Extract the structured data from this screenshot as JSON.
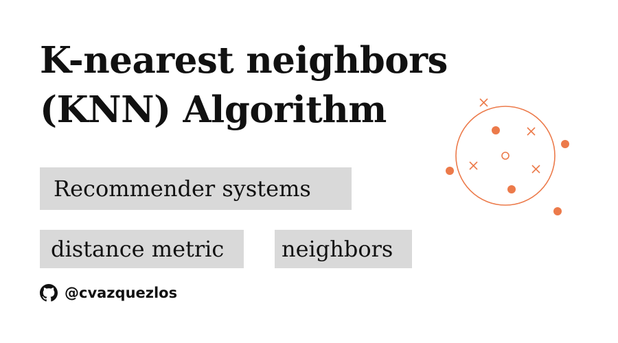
{
  "title": {
    "line1": "K-nearest neighbors",
    "line2": "(KNN) Algorithm"
  },
  "tags": {
    "recommender": "Recommender systems",
    "distance": "distance metric",
    "neighbors": "neighbors"
  },
  "author": {
    "handle": "@cvazquezlos",
    "icon": "github-icon"
  },
  "colors": {
    "accent": "#ec7a4a",
    "tag_background": "#d9d9d9",
    "text": "#111111"
  },
  "graphic": {
    "icon": "knn-diagram-icon"
  }
}
